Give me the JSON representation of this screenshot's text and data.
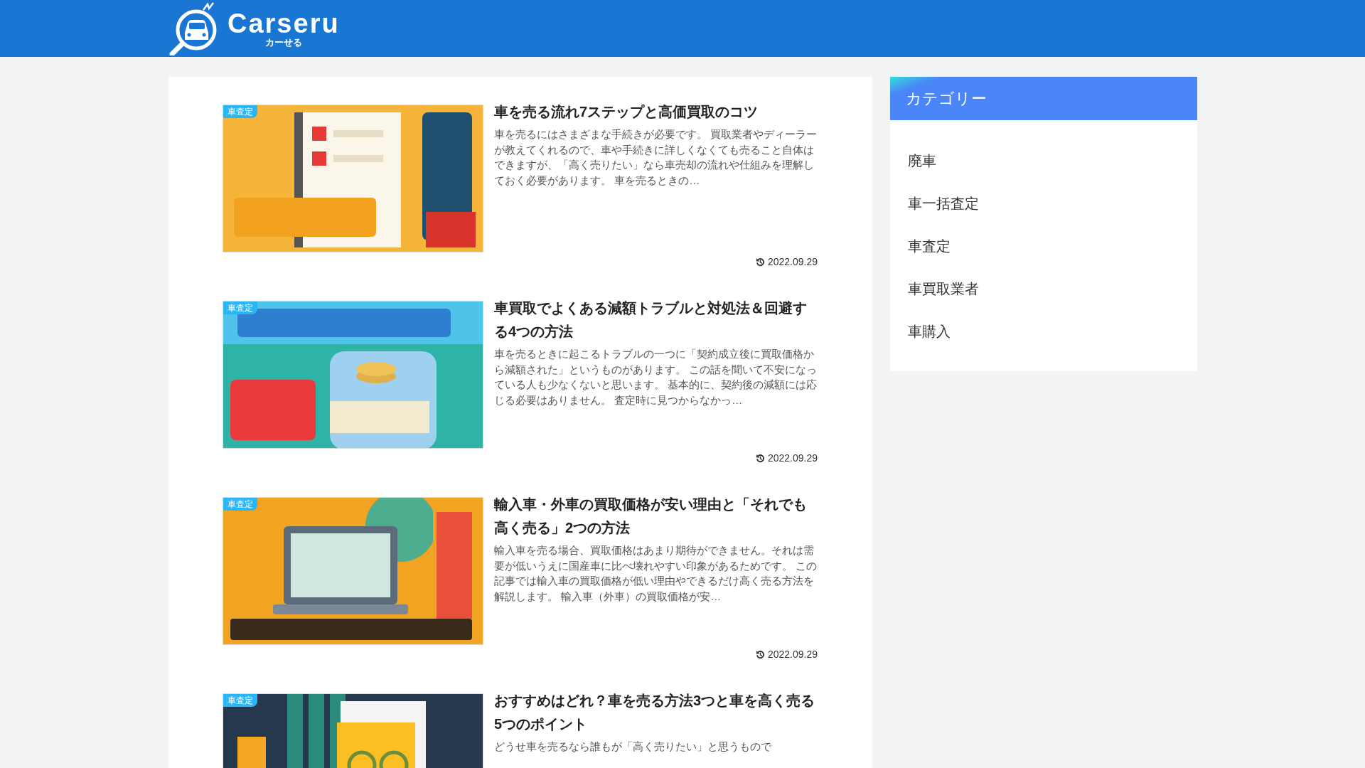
{
  "header": {
    "logo": {
      "name": "Carseru",
      "kana": "カーせる"
    }
  },
  "articles": [
    {
      "badge": "車査定",
      "title": "車を売る流れ7ステップと高価買取のコツ",
      "excerpt": "車を売るにはさまざまな手続きが必要です。 買取業者やディーラーが教えてくれるので、車や手続きに詳しくなくても売ること自体はできますが、「高く売りたい」なら車売却の流れや仕組みを理解しておく必要があります。 車を売るときの…",
      "date": "2022.09.29"
    },
    {
      "badge": "車査定",
      "title": "車買取でよくある減額トラブルと対処法＆回避する4つの方法",
      "excerpt": "車を売るときに起こるトラブルの一つに「契約成立後に買取価格から減額された」というものがあります。 この話を聞いて不安になっている人も少なくないと思います。 基本的に、契約後の減額には応じる必要はありません。 査定時に見つからなかっ…",
      "date": "2022.09.29"
    },
    {
      "badge": "車査定",
      "title": "輸入車・外車の買取価格が安い理由と「それでも高く売る」2つの方法",
      "excerpt": "輸入車を売る場合、買取価格はあまり期待ができません。それは需要が低いうえに国産車に比べ壊れやすい印象があるためです。 この記事では輸入車の買取価格が低い理由やできるだけ高く売る方法を解説します。 輸入車（外車）の買取価格が安…",
      "date": "2022.09.29"
    },
    {
      "badge": "車査定",
      "title": "おすすめはどれ？車を売る方法3つと車を高く売る5つのポイント",
      "excerpt": "どうせ車を売るなら誰もが「高く売りたい」と思うもので"
    }
  ],
  "sidebar": {
    "title": "カテゴリー",
    "items": [
      "廃車",
      "車一括査定",
      "車査定",
      "車買取業者",
      "車購入"
    ]
  }
}
